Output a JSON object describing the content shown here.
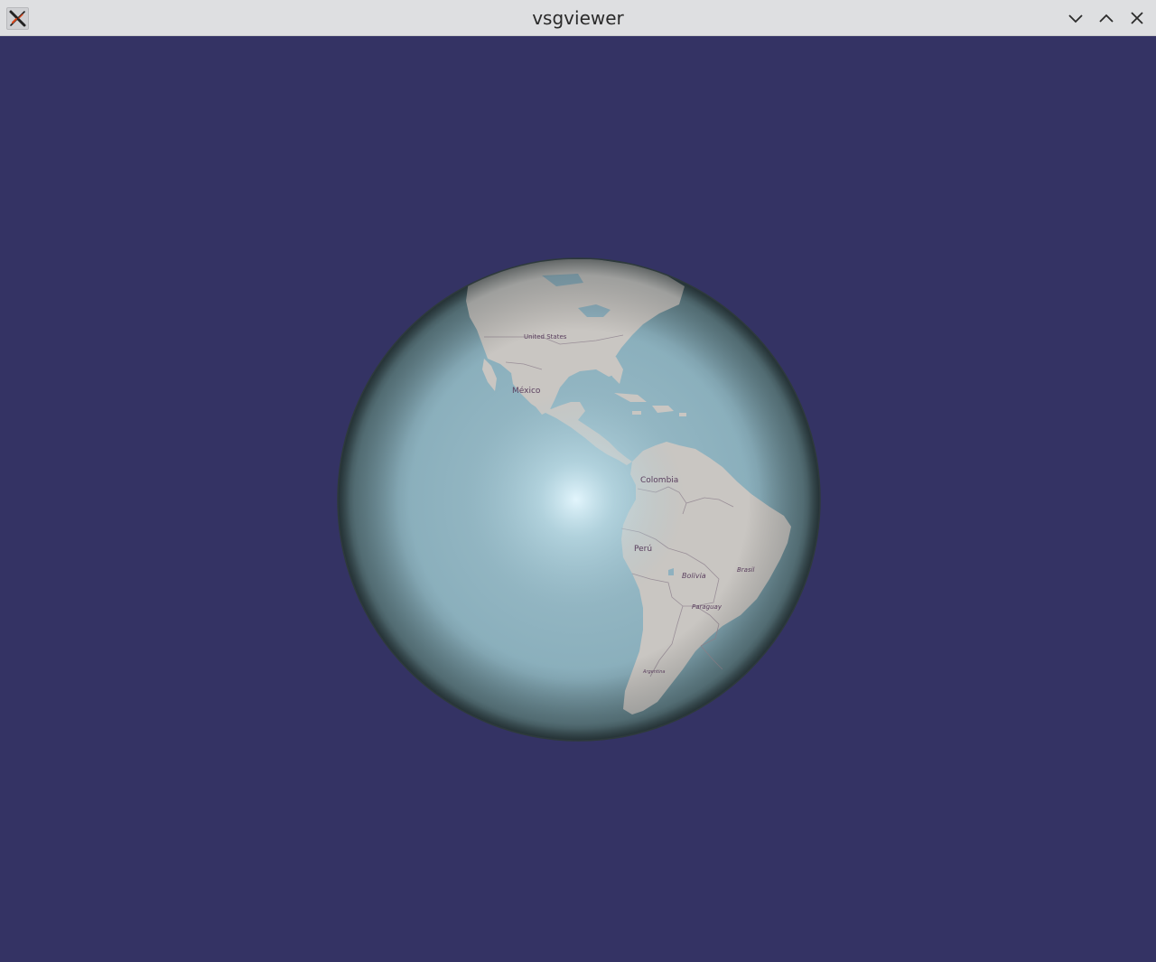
{
  "window": {
    "title": "vsgviewer",
    "app_icon": "x-logo-icon",
    "controls": {
      "minimize": "chevron-down-icon",
      "maximize": "chevron-up-icon",
      "close": "close-icon"
    }
  },
  "scene": {
    "background_color": "#343364",
    "ocean_color": "#8fb1bf",
    "land_color": "#c9c6c2",
    "labels": {
      "united_states": "United States",
      "mexico": "México",
      "colombia": "Colombia",
      "peru": "Perú",
      "bolivia": "Bolivia",
      "brasil": "Brasil",
      "paraguay": "Paraguay",
      "argentina": "Argentina"
    }
  }
}
